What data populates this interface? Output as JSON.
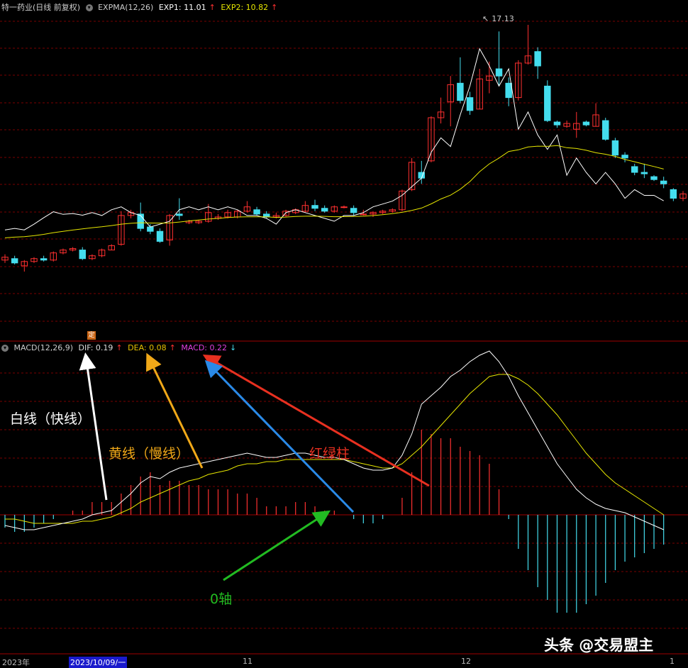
{
  "header_top": {
    "title": "特一药业(日线 前复权)",
    "indicator": "EXPMA(12,26)",
    "exp1_label": "EXP1: 11.01",
    "exp2_label": "EXP2: 10.82"
  },
  "header_macd": {
    "indicator": "MACD(12,26,9)",
    "dif_label": "DIF: 0.19",
    "dea_label": "DEA: 0.08",
    "macd_label": "MACD: 0.22"
  },
  "colors": {
    "up": "#ff3030",
    "down": "#44ddee",
    "white_line": "#ffffff",
    "yellow_line": "#e6e600",
    "grid": "#7a0000",
    "dif_label": "#dddddd",
    "dea_label": "#e6c200",
    "macd_label": "#e040e0"
  },
  "annotations": {
    "white_line": "白线（快线）",
    "yellow_line": "黄线（慢线）",
    "red_green_bars": "红绿柱",
    "zero_axis": "0轴"
  },
  "x_axis": {
    "year": "2023年",
    "cursor_date": "2023/10/09/一",
    "month_11": "11",
    "month_12": "12",
    "month_1": "1"
  },
  "max_marker": "17.13",
  "watermark": "头条 @交易盟主",
  "ding_badge": "定",
  "chart_data": [
    {
      "type": "candlestick",
      "title": "特一药业(日线 前复权)",
      "series": [
        {
          "name": "EXP1",
          "values": [
            10.0,
            10.05,
            10.0,
            10.2,
            10.42,
            10.63,
            10.54,
            10.57,
            10.51,
            10.6,
            10.5,
            10.7,
            10.8,
            10.6,
            10.5,
            10.1,
            10.2,
            10.3,
            10.7,
            10.8,
            10.7,
            10.8,
            10.7,
            10.8,
            10.7,
            10.5,
            10.5,
            10.4,
            10.2,
            10.6,
            10.7,
            10.6,
            10.5,
            10.4,
            10.3,
            10.5,
            10.5,
            10.6,
            10.8,
            10.9,
            11.0,
            11.2,
            11.5,
            11.8,
            12.7,
            13.2,
            12.9,
            14.0,
            15.0,
            16.3,
            15.7,
            15.0,
            15.6,
            13.5,
            14.1,
            13.3,
            12.8,
            13.3,
            11.9,
            12.5,
            12.0,
            11.6,
            12.0,
            11.6,
            11.1,
            11.4,
            11.2,
            11.2,
            11.01
          ]
        }
      ],
      "candles": [
        {
          "o": 8.95,
          "h": 9.15,
          "l": 8.85,
          "c": 9.05
        },
        {
          "o": 9.0,
          "h": 9.1,
          "l": 8.8,
          "c": 8.85
        },
        {
          "o": 8.75,
          "h": 8.95,
          "l": 8.55,
          "c": 8.9
        },
        {
          "o": 8.9,
          "h": 9.05,
          "l": 8.85,
          "c": 9.0
        },
        {
          "o": 9.0,
          "h": 9.1,
          "l": 8.9,
          "c": 8.95
        },
        {
          "o": 8.95,
          "h": 9.25,
          "l": 8.9,
          "c": 9.2
        },
        {
          "o": 9.2,
          "h": 9.35,
          "l": 9.15,
          "c": 9.3
        },
        {
          "o": 9.3,
          "h": 9.4,
          "l": 9.25,
          "c": 9.35
        },
        {
          "o": 9.3,
          "h": 9.4,
          "l": 8.95,
          "c": 9.0
        },
        {
          "o": 9.0,
          "h": 9.15,
          "l": 8.95,
          "c": 9.1
        },
        {
          "o": 9.1,
          "h": 9.35,
          "l": 9.05,
          "c": 9.3
        },
        {
          "o": 9.3,
          "h": 9.5,
          "l": 9.3,
          "c": 9.45
        },
        {
          "o": 9.5,
          "h": 10.65,
          "l": 9.45,
          "c": 10.5
        },
        {
          "o": 10.5,
          "h": 10.7,
          "l": 10.4,
          "c": 10.6
        },
        {
          "o": 10.55,
          "h": 10.95,
          "l": 9.95,
          "c": 10.05
        },
        {
          "o": 10.1,
          "h": 10.2,
          "l": 9.85,
          "c": 9.95
        },
        {
          "o": 9.95,
          "h": 10.05,
          "l": 9.55,
          "c": 9.6
        },
        {
          "o": 9.65,
          "h": 10.55,
          "l": 9.45,
          "c": 10.5
        },
        {
          "o": 10.55,
          "h": 11.1,
          "l": 10.35,
          "c": 10.5
        },
        {
          "o": 10.25,
          "h": 10.35,
          "l": 10.2,
          "c": 10.3
        },
        {
          "o": 10.25,
          "h": 10.35,
          "l": 10.2,
          "c": 10.3
        },
        {
          "o": 10.3,
          "h": 10.9,
          "l": 10.25,
          "c": 10.6
        },
        {
          "o": 10.4,
          "h": 10.55,
          "l": 10.35,
          "c": 10.45
        },
        {
          "o": 10.45,
          "h": 10.7,
          "l": 10.4,
          "c": 10.6
        },
        {
          "o": 10.45,
          "h": 10.7,
          "l": 10.4,
          "c": 10.65
        },
        {
          "o": 10.65,
          "h": 11.0,
          "l": 10.6,
          "c": 10.8
        },
        {
          "o": 10.7,
          "h": 10.8,
          "l": 10.5,
          "c": 10.55
        },
        {
          "o": 10.55,
          "h": 10.65,
          "l": 10.4,
          "c": 10.45
        },
        {
          "o": 10.45,
          "h": 10.6,
          "l": 10.4,
          "c": 10.5
        },
        {
          "o": 10.5,
          "h": 10.7,
          "l": 10.45,
          "c": 10.65
        },
        {
          "o": 10.6,
          "h": 10.75,
          "l": 10.55,
          "c": 10.7
        },
        {
          "o": 10.65,
          "h": 11.0,
          "l": 10.6,
          "c": 10.85
        },
        {
          "o": 10.85,
          "h": 11.05,
          "l": 10.65,
          "c": 10.75
        },
        {
          "o": 10.75,
          "h": 10.85,
          "l": 10.6,
          "c": 10.65
        },
        {
          "o": 10.65,
          "h": 10.85,
          "l": 10.6,
          "c": 10.8
        },
        {
          "o": 10.8,
          "h": 10.85,
          "l": 10.75,
          "c": 10.8
        },
        {
          "o": 10.75,
          "h": 10.85,
          "l": 10.5,
          "c": 10.6
        },
        {
          "o": 10.55,
          "h": 10.7,
          "l": 10.5,
          "c": 10.55
        },
        {
          "o": 10.55,
          "h": 10.65,
          "l": 10.45,
          "c": 10.6
        },
        {
          "o": 10.6,
          "h": 10.7,
          "l": 10.55,
          "c": 10.65
        },
        {
          "o": 10.65,
          "h": 10.75,
          "l": 10.6,
          "c": 10.7
        },
        {
          "o": 10.7,
          "h": 11.4,
          "l": 10.65,
          "c": 11.35
        },
        {
          "o": 11.4,
          "h": 12.5,
          "l": 11.35,
          "c": 12.35
        },
        {
          "o": 12.0,
          "h": 12.4,
          "l": 11.6,
          "c": 11.8
        },
        {
          "o": 12.4,
          "h": 13.95,
          "l": 12.35,
          "c": 13.9
        },
        {
          "o": 13.9,
          "h": 14.6,
          "l": 13.7,
          "c": 14.1
        },
        {
          "o": 14.45,
          "h": 15.35,
          "l": 13.6,
          "c": 15.05
        },
        {
          "o": 15.1,
          "h": 16.0,
          "l": 14.4,
          "c": 14.5
        },
        {
          "o": 14.6,
          "h": 14.8,
          "l": 14.0,
          "c": 14.15
        },
        {
          "o": 14.2,
          "h": 15.6,
          "l": 14.2,
          "c": 15.25
        },
        {
          "o": 15.2,
          "h": 15.85,
          "l": 14.75,
          "c": 15.35
        },
        {
          "o": 15.6,
          "h": 16.9,
          "l": 15.0,
          "c": 15.35
        },
        {
          "o": 15.1,
          "h": 15.3,
          "l": 14.3,
          "c": 14.6
        },
        {
          "o": 14.6,
          "h": 15.9,
          "l": 14.5,
          "c": 15.8
        },
        {
          "o": 15.8,
          "h": 17.13,
          "l": 15.75,
          "c": 16.05
        },
        {
          "o": 16.2,
          "h": 16.35,
          "l": 15.25,
          "c": 15.7
        },
        {
          "o": 15.0,
          "h": 15.2,
          "l": 13.75,
          "c": 13.8
        },
        {
          "o": 13.75,
          "h": 13.8,
          "l": 13.55,
          "c": 13.65
        },
        {
          "o": 13.6,
          "h": 13.8,
          "l": 13.55,
          "c": 13.7
        },
        {
          "o": 13.5,
          "h": 14.1,
          "l": 13.2,
          "c": 13.7
        },
        {
          "o": 13.75,
          "h": 13.8,
          "l": 13.6,
          "c": 13.65
        },
        {
          "o": 13.6,
          "h": 14.4,
          "l": 13.6,
          "c": 14.0
        },
        {
          "o": 13.8,
          "h": 13.9,
          "l": 13.1,
          "c": 13.15
        },
        {
          "o": 13.1,
          "h": 13.2,
          "l": 12.5,
          "c": 12.6
        },
        {
          "o": 12.6,
          "h": 12.7,
          "l": 12.35,
          "c": 12.5
        },
        {
          "o": 12.2,
          "h": 12.3,
          "l": 11.9,
          "c": 12.0
        },
        {
          "o": 12.0,
          "h": 12.3,
          "l": 11.8,
          "c": 11.95
        },
        {
          "o": 11.85,
          "h": 11.9,
          "l": 11.7,
          "c": 11.75
        },
        {
          "o": 11.7,
          "h": 11.85,
          "l": 11.45,
          "c": 11.6
        },
        {
          "o": 11.4,
          "h": 11.45,
          "l": 11.0,
          "c": 11.1
        },
        {
          "o": 11.1,
          "h": 11.35,
          "l": 11.0,
          "c": 11.25
        }
      ]
    },
    {
      "type": "macd",
      "title": "MACD(12,26,9)",
      "series": [
        {
          "name": "DIF",
          "values": [
            -0.05,
            -0.06,
            -0.07,
            -0.07,
            -0.06,
            -0.05,
            -0.04,
            -0.03,
            -0.02,
            0.0,
            0.01,
            0.02,
            0.06,
            0.1,
            0.15,
            0.18,
            0.17,
            0.2,
            0.22,
            0.23,
            0.24,
            0.25,
            0.26,
            0.27,
            0.28,
            0.29,
            0.28,
            0.27,
            0.27,
            0.28,
            0.29,
            0.29,
            0.28,
            0.27,
            0.27,
            0.26,
            0.24,
            0.22,
            0.21,
            0.21,
            0.22,
            0.28,
            0.38,
            0.52,
            0.56,
            0.6,
            0.65,
            0.68,
            0.72,
            0.75,
            0.77,
            0.72,
            0.65,
            0.56,
            0.48,
            0.4,
            0.32,
            0.24,
            0.18,
            0.12,
            0.08,
            0.05,
            0.03,
            0.02,
            0.01,
            -0.01,
            -0.03,
            -0.05,
            -0.07
          ]
        },
        {
          "name": "DEA",
          "values": [
            -0.02,
            -0.02,
            -0.03,
            -0.04,
            -0.04,
            -0.04,
            -0.04,
            -0.04,
            -0.03,
            -0.03,
            -0.02,
            -0.01,
            0.01,
            0.03,
            0.06,
            0.08,
            0.1,
            0.12,
            0.14,
            0.16,
            0.17,
            0.19,
            0.2,
            0.21,
            0.23,
            0.24,
            0.24,
            0.25,
            0.25,
            0.26,
            0.26,
            0.26,
            0.26,
            0.26,
            0.26,
            0.26,
            0.25,
            0.24,
            0.23,
            0.22,
            0.22,
            0.24,
            0.28,
            0.32,
            0.37,
            0.42,
            0.47,
            0.52,
            0.57,
            0.61,
            0.65,
            0.66,
            0.66,
            0.64,
            0.61,
            0.57,
            0.52,
            0.47,
            0.41,
            0.35,
            0.29,
            0.24,
            0.19,
            0.15,
            0.12,
            0.09,
            0.06,
            0.03,
            0.0
          ]
        },
        {
          "name": "MACD",
          "values": [
            -0.06,
            -0.08,
            -0.08,
            -0.06,
            -0.04,
            -0.02,
            0.0,
            0.02,
            0.02,
            0.06,
            0.06,
            0.06,
            0.1,
            0.14,
            0.18,
            0.2,
            0.14,
            0.16,
            0.16,
            0.14,
            0.14,
            0.12,
            0.12,
            0.12,
            0.1,
            0.1,
            0.08,
            0.04,
            0.04,
            0.04,
            0.06,
            0.06,
            0.04,
            0.02,
            0.02,
            0.0,
            -0.02,
            -0.04,
            -0.04,
            -0.02,
            0.0,
            0.08,
            0.2,
            0.4,
            0.38,
            0.36,
            0.36,
            0.32,
            0.3,
            0.28,
            0.24,
            0.12,
            -0.02,
            -0.16,
            -0.26,
            -0.34,
            -0.4,
            -0.46,
            -0.46,
            -0.46,
            -0.42,
            -0.38,
            -0.32,
            -0.26,
            -0.22,
            -0.2,
            -0.18,
            -0.16,
            -0.14
          ]
        }
      ]
    }
  ]
}
